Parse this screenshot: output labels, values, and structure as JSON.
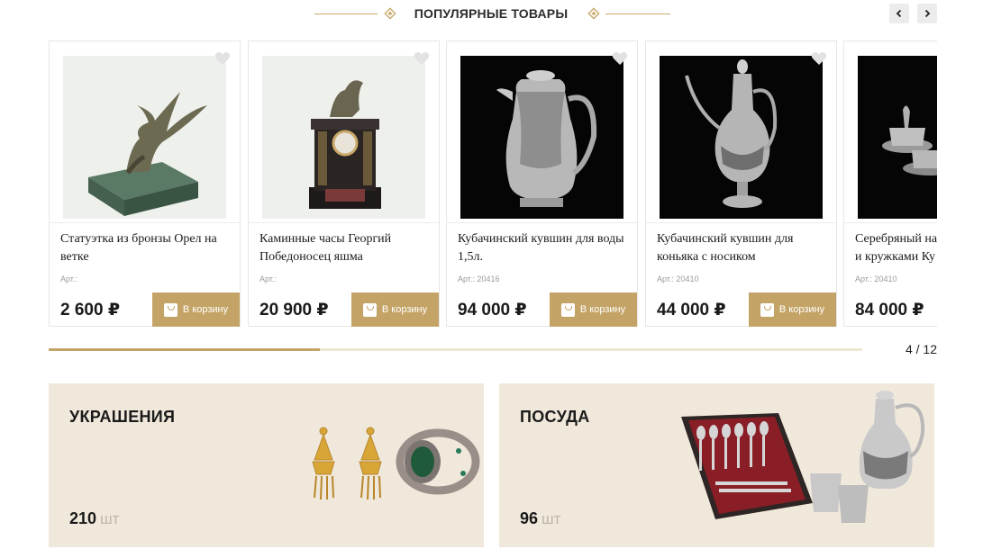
{
  "section": {
    "title": "ПОПУЛЯРНЫЕ ТОВАРЫ",
    "prev_icon": "chevron-left-icon",
    "next_icon": "chevron-right-icon"
  },
  "cart_label": "В корзину",
  "currency": "₽",
  "products": [
    {
      "name": "Статуэтка из бронзы Орел на ветке",
      "art": "Арт.:",
      "price": "2 600",
      "image": "bronze-eagle-statuette"
    },
    {
      "name": "Каминные часы Георгий Победоносец яшма",
      "art": "Арт.:",
      "price": "20 900",
      "image": "fireplace-clock"
    },
    {
      "name": "Кубачинский кувшин для воды 1,5л.",
      "art": "Арт.: 20416",
      "price": "94 000",
      "image": "silver-water-jug"
    },
    {
      "name": "Кубачинский кувшин для коньяка с носиком",
      "art": "Арт.: 20410",
      "price": "44 000",
      "image": "silver-cognac-ewer"
    },
    {
      "name": "Серебряный набор с чашками и кружками Ку",
      "art": "Арт.: 20410",
      "price": "84 000",
      "image": "silver-cup-set"
    }
  ],
  "pager": {
    "text": "4 / 12",
    "progress": 0.333
  },
  "categories": [
    {
      "title": "УКРАШЕНИЯ",
      "count": "210",
      "unit": "шт"
    },
    {
      "title": "ПОСУДА",
      "count": "96",
      "unit": "шт"
    }
  ],
  "colors": {
    "accent": "#c4a466",
    "tile_bg": "#f0e8db",
    "track": "#efe6d4"
  }
}
